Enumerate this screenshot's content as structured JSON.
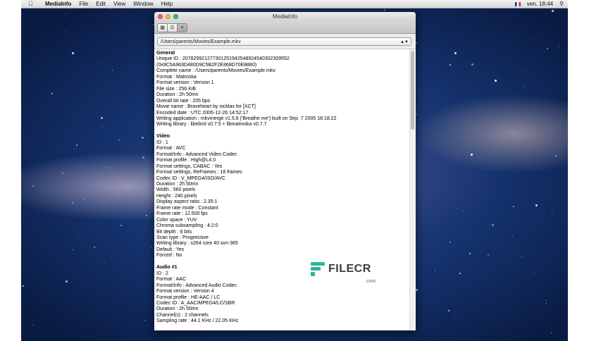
{
  "menubar": {
    "app_name": "MediaInfo",
    "items": [
      "File",
      "Edit",
      "View",
      "Window",
      "Help"
    ],
    "clock": "ven. 18:44"
  },
  "window": {
    "title": "MediaInfo",
    "file_path": "/Users/parents/Movies/Example.mkv"
  },
  "report": [
    {
      "heading": "General",
      "lines": [
        "Unique ID : 207829921277301251942548924540302309552",
        "(0x9C5A963D480D9C5B2F2E868D70E8880)",
        "Complete name : /Users/parents/Movies/Example.mkv",
        "Format : Matroska",
        "Format version : Version 1",
        "File size : 256 KiB",
        "Duration : 2h 50mn",
        "Overall bit rate : 205 bps",
        "Movie name : Braveheart by nicklas for [XCT]",
        "Encoded date : UTC 2005-12-26 14:52:17",
        "Writing application : mkvmerge v1.5.6 ('Breathe me') built on Sep  7 2005 18:18:22",
        "Writing library : libebml v0.7.5 + libmatroska v0.7.7"
      ]
    },
    {
      "heading": "Video",
      "lines": [
        "ID : 1",
        "Format : AVC",
        "Format/Info : Advanced Video Codec",
        "Format profile : High@L4.0",
        "Format settings, CABAC : Yes",
        "Format settings, ReFrames : 16 frames",
        "Codec ID : V_MPEG4/ISO/AVC",
        "Duration : 2h 50mn",
        "Width : 560 pixels",
        "Height : 240 pixels",
        "Display aspect ratio : 2.35:1",
        "Frame rate mode : Constant",
        "Frame rate : 12.500 fps",
        "Color space : YUV",
        "Chroma subsampling : 4:2:0",
        "Bit depth : 8 bits",
        "Scan type : Progressive",
        "Writing library : x264 core 40 svn-365",
        "Default : Yes",
        "Forced : No"
      ]
    },
    {
      "heading": "Audio #1",
      "lines": [
        "ID : 2",
        "Format : AAC",
        "Format/Info : Advanced Audio Codec",
        "Format version : Version 4",
        "Format profile : HE-AAC / LC",
        "Codec ID : A_AAC/MPEG4/LC/SBR",
        "Duration : 2h 50mn",
        "Channel(s) : 2 channels",
        "Sampling rate : 44.1 KHz / 22.05 KHz"
      ]
    }
  ],
  "watermark": {
    "brand": "FILECR",
    "suffix": ".com"
  }
}
